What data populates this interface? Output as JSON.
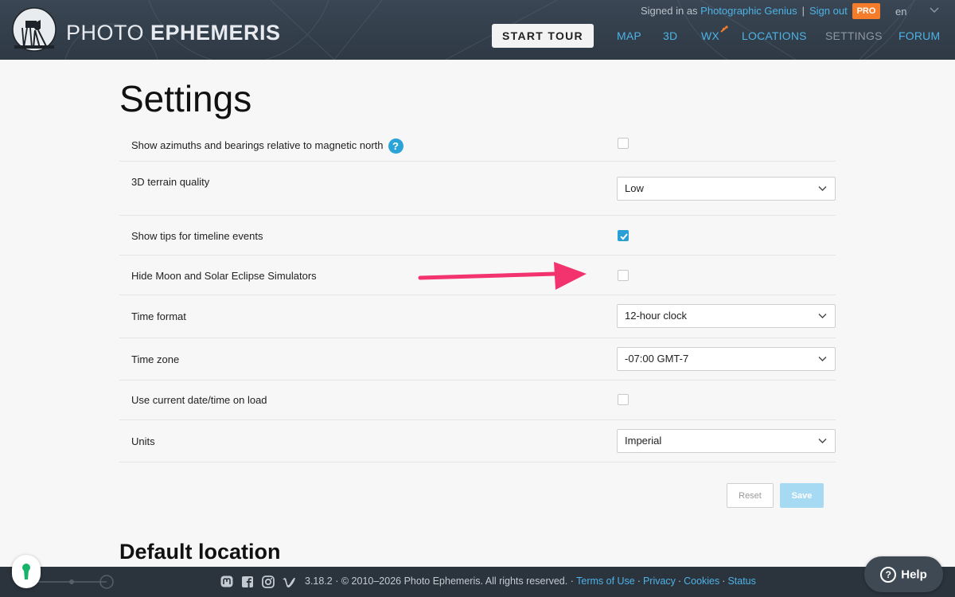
{
  "header": {
    "brand_light": "PHOTO ",
    "brand_bold": "EPHEMERIS",
    "signed_in_prefix": "Signed in as ",
    "user_name": "Photographic Genius",
    "separator": "|",
    "sign_out": "Sign out",
    "pro_badge": "PRO",
    "language": "en",
    "start_tour": "START TOUR",
    "nav": [
      {
        "label": "MAP"
      },
      {
        "label": "3D"
      },
      {
        "label": "WX"
      },
      {
        "label": "LOCATIONS"
      },
      {
        "label": "SETTINGS"
      },
      {
        "label": "FORUM"
      }
    ]
  },
  "settings": {
    "title": "Settings",
    "magnetic_north": {
      "label": "Show azimuths and bearings relative to magnetic north",
      "help_icon": "?",
      "checked": false
    },
    "terrain_quality": {
      "label": "3D terrain quality",
      "value": "Low"
    },
    "timeline_tips": {
      "label": "Show tips for timeline events",
      "checked": true
    },
    "hide_simulators": {
      "label": "Hide Moon and Solar Eclipse Simulators",
      "checked": false
    },
    "time_format": {
      "label": "Time format",
      "value": "12-hour clock"
    },
    "time_zone": {
      "label": "Time zone",
      "value": "-07:00 GMT-7"
    },
    "current_datetime": {
      "label": "Use current date/time on load",
      "checked": false
    },
    "units": {
      "label": "Units",
      "value": "Imperial"
    },
    "reset_button": "Reset",
    "save_button": "Save"
  },
  "default_location": {
    "title": "Default location"
  },
  "footer": {
    "version_text": "3.18.2 · © 2010–2026 Photo Ephemeris. All rights reserved. ·",
    "terms": "Terms of Use",
    "privacy": "Privacy",
    "cookies": "Cookies",
    "status": "Status",
    "dot": "·",
    "icons": [
      "mastodon-icon",
      "facebook-icon",
      "instagram-icon",
      "vimeo-icon"
    ]
  },
  "help_button": {
    "icon": "?",
    "label": "Help"
  },
  "annotation": {
    "color": "#f2336e"
  },
  "colors": {
    "accent": "#4db3e6",
    "pro": "#f47c2a",
    "checkbox_checked": "#2a9fd6",
    "header_bg": "#323d49"
  }
}
